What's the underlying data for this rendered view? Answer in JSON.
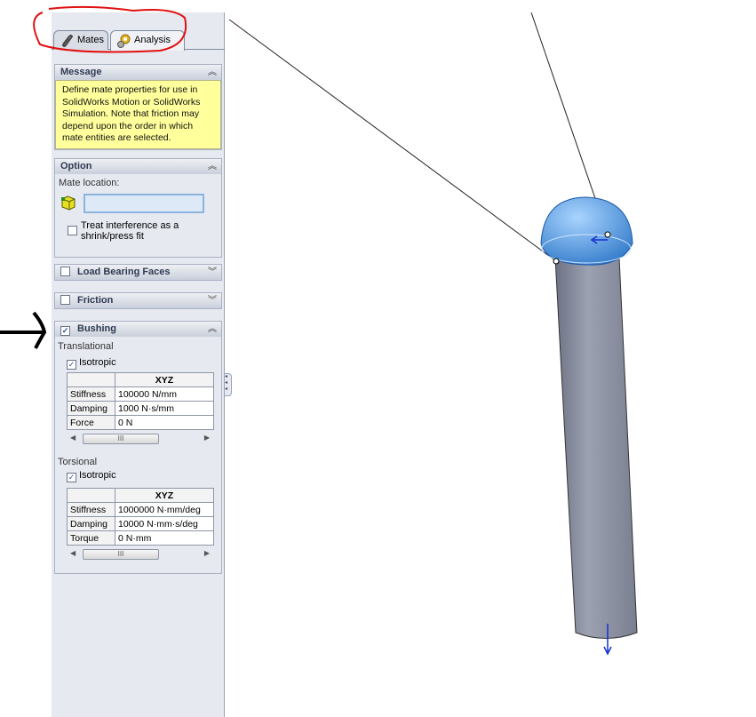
{
  "tabs": [
    {
      "label": "Mates",
      "icon": "paperclip-icon"
    },
    {
      "label": "Analysis",
      "icon": "gears-icon"
    }
  ],
  "message": {
    "title": "Message",
    "text": "Define mate properties for use in SolidWorks Motion or SolidWorks Simulation. Note that friction may depend upon the order in which mate entities are selected."
  },
  "option": {
    "title": "Option",
    "mate_location_label": "Mate location:",
    "mate_location_value": "",
    "interference_label": "Treat interference as a shrink/press fit",
    "interference_checked": false
  },
  "load_bearing": {
    "title": "Load Bearing Faces",
    "checked": false
  },
  "friction": {
    "title": "Friction",
    "checked": false
  },
  "bushing": {
    "title": "Bushing",
    "checked": true,
    "translational": {
      "label": "Translational",
      "isotropic_label": "Isotropic",
      "isotropic": true,
      "column": "XYZ",
      "rows": [
        {
          "name": "Stiffness",
          "value": "100000 N/mm"
        },
        {
          "name": "Damping",
          "value": "1000 N·s/mm"
        },
        {
          "name": "Force",
          "value": "0 N"
        }
      ]
    },
    "torsional": {
      "label": "Torsional",
      "isotropic_label": "Isotropic",
      "isotropic": true,
      "column": "XYZ",
      "rows": [
        {
          "name": "Stiffness",
          "value": "1000000 N·mm/deg"
        },
        {
          "name": "Damping",
          "value": "10000 N·mm·s/deg"
        },
        {
          "name": "Torque",
          "value": "0 N·mm"
        }
      ]
    }
  },
  "scroll_thumb": "III",
  "colors": {
    "message_bg": "#ffff9c",
    "part_blue": "#4a90d9",
    "cylinder": "#8a90a0",
    "annotation_red": "#e01010"
  }
}
